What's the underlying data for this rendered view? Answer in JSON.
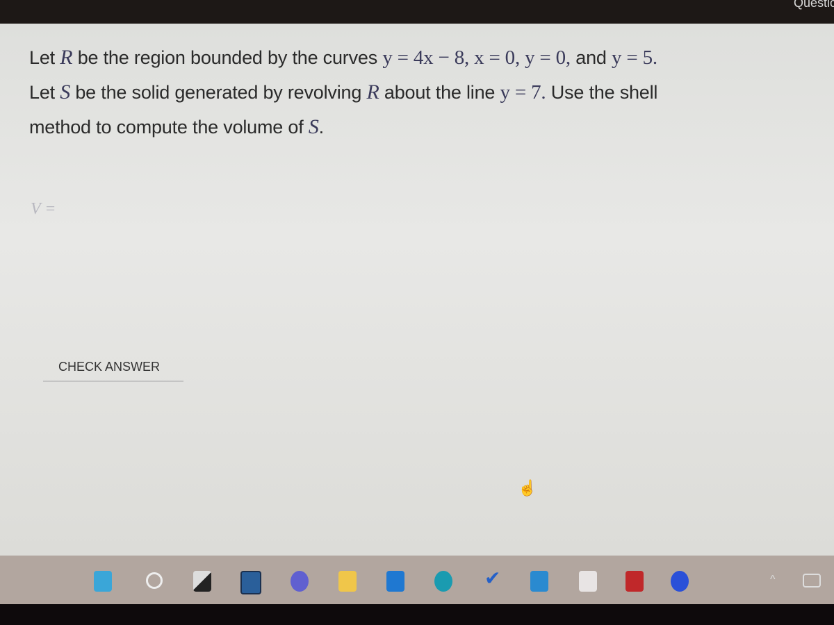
{
  "header": {
    "title": "Questio"
  },
  "question": {
    "line1": {
      "a": "Let ",
      "R": "R",
      "b": " be the region bounded by the curves ",
      "eq1": "y = 4x − 8, x = 0, y = 0,",
      "c": " and ",
      "eq2": "y = 5."
    },
    "line2": {
      "a": "Let ",
      "S": "S",
      "b": " be the solid generated by revolving ",
      "R": "R",
      "c": " about the line ",
      "eq": "y = 7.",
      "d": " Use the shell"
    },
    "line3": {
      "a": "method to compute the volume of ",
      "S": "S",
      "b": "."
    }
  },
  "answer": {
    "label": "V ="
  },
  "check_answer_label": "CHECK ANSWER",
  "taskbar": {
    "icons": [
      "windows-start",
      "search",
      "task-view",
      "widgets",
      "teams-chat",
      "file-explorer",
      "whiteboard",
      "edge",
      "todo",
      "mail",
      "snipping-tool",
      "acrobat",
      "discord"
    ],
    "tray": [
      "chevron-up",
      "keyboard"
    ]
  }
}
